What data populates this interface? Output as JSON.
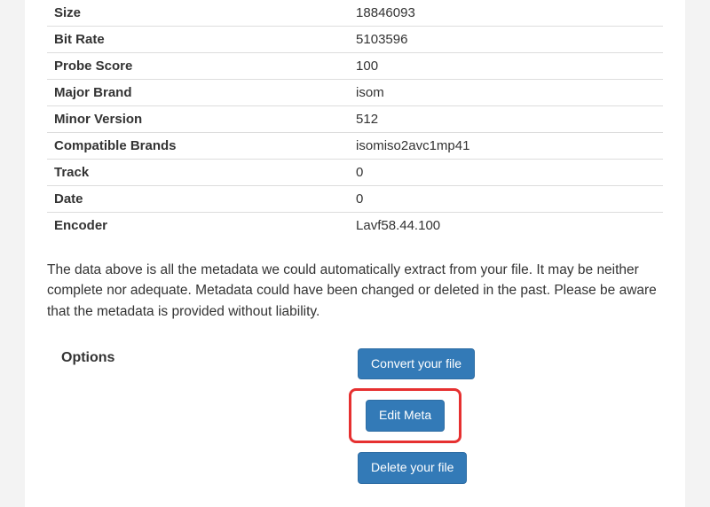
{
  "metadata_rows": [
    {
      "key": "Size",
      "value": "18846093"
    },
    {
      "key": "Bit Rate",
      "value": "5103596"
    },
    {
      "key": "Probe Score",
      "value": "100"
    },
    {
      "key": "Major Brand",
      "value": "isom"
    },
    {
      "key": "Minor Version",
      "value": "512"
    },
    {
      "key": "Compatible Brands",
      "value": "isomiso2avc1mp41"
    },
    {
      "key": "Track",
      "value": "0"
    },
    {
      "key": "Date",
      "value": "0"
    },
    {
      "key": "Encoder",
      "value": "Lavf58.44.100"
    }
  ],
  "explanation": "The data above is all the metadata we could automatically extract from your file. It may be neither complete nor adequate. Metadata could have been changed or deleted in the past. Please be aware that the metadata is provided without liability.",
  "options": {
    "label": "Options",
    "convert_label": "Convert your file",
    "edit_label": "Edit Meta",
    "delete_label": "Delete your file"
  }
}
